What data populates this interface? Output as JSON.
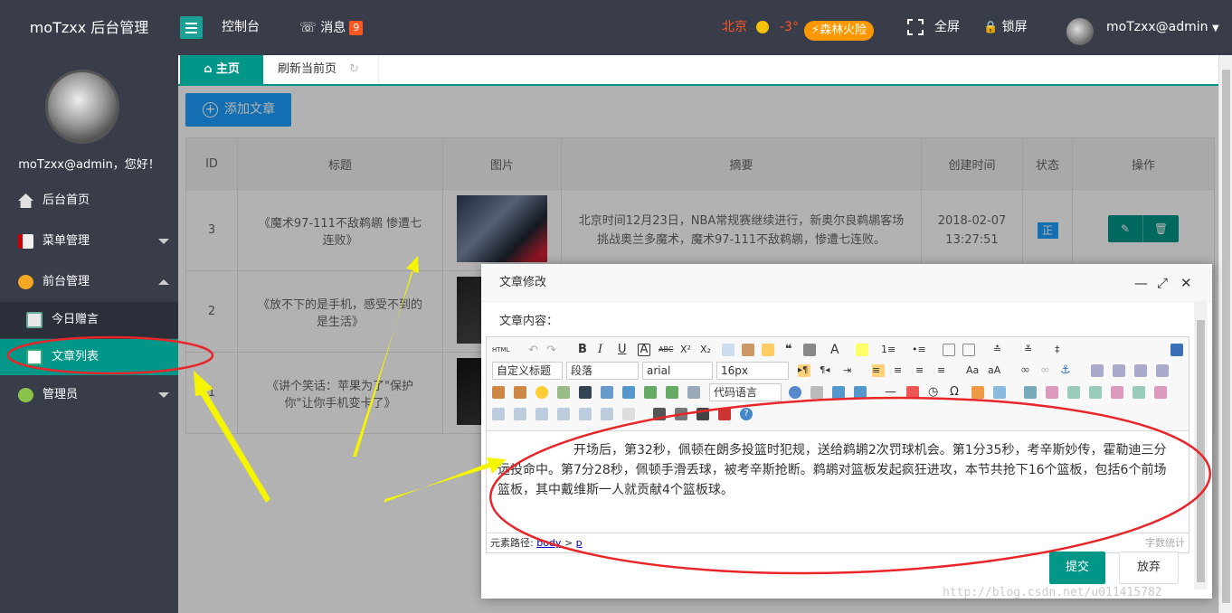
{
  "header": {
    "logo": "moTzxx 后台管理",
    "console": "控制台",
    "messages_label": "消息",
    "messages_count": "9",
    "city": "北京",
    "temperature": "-3°",
    "fire_risk": "森林火险",
    "fullscreen": "全屏",
    "lock": "锁屏",
    "user": "moTzxx@admin"
  },
  "sidebar": {
    "greeting": "moTzxx@admin，您好！",
    "items": [
      {
        "label": "后台首页",
        "icon": "home-icon"
      },
      {
        "label": "菜单管理",
        "icon": "menu-icon"
      },
      {
        "label": "前台管理",
        "icon": "monitor-icon"
      },
      {
        "label": "今日赠言",
        "icon": "quote-icon"
      },
      {
        "label": "文章列表",
        "icon": "article-icon"
      },
      {
        "label": "管理员",
        "icon": "admin-icon"
      }
    ]
  },
  "tabs": {
    "home": "主页",
    "refresh": "刷新当前页"
  },
  "toolbar": {
    "add_article": "添加文章"
  },
  "table": {
    "columns": [
      "ID",
      "标题",
      "图片",
      "摘要",
      "创建时间",
      "状态",
      "操作"
    ],
    "rows": [
      {
        "id": "3",
        "title": "《魔术97-111不敌鹈鹕 惨遭七连败》",
        "summary": "北京时间12月23日，NBA常规赛继续进行，新奥尔良鹈鹕客场挑战奥兰多魔术，魔术97-111不敌鹈鹕，惨遭七连败。",
        "time": "2018-02-07 13:27:51",
        "status": "正"
      },
      {
        "id": "2",
        "title": "《放不下的是手机，感受不到的是生活》"
      },
      {
        "id": "1",
        "title": "《讲个笑话：苹果为了\"保护你\"让你手机变卡了》"
      }
    ]
  },
  "dialog": {
    "title": "文章修改",
    "content_label": "文章内容：",
    "heading_select": "自定义标题",
    "paragraph_select": "段落",
    "font_select": "arial",
    "size_select": "16px",
    "code_select": "代码语言",
    "content": "开场后，第32秒，佩顿在朗多投篮时犯规，送给鹈鹕2次罚球机会。第1分35秒，考辛斯妙传，霍勒迪三分远投命中。第7分28秒，佩顿手滑丢球，被考辛斯抢断。鹈鹕对篮板发起疯狂进攻，本节共抢下16个篮板，包括6个前场篮板，其中戴维斯一人就贡献4个篮板球。",
    "path_label": "元素路径:",
    "path_body": "body",
    "path_sep": ">",
    "path_p": "p",
    "word_count": "字数统计",
    "submit": "提交",
    "cancel": "放弃"
  },
  "watermark": "http://blog.csdn.net/u011415782",
  "colors": {
    "topbar": "#393d49",
    "accent": "#009688",
    "blue": "#1e9fff",
    "annotation_red": "#e8262a",
    "annotation_yellow": "#f5f500"
  }
}
